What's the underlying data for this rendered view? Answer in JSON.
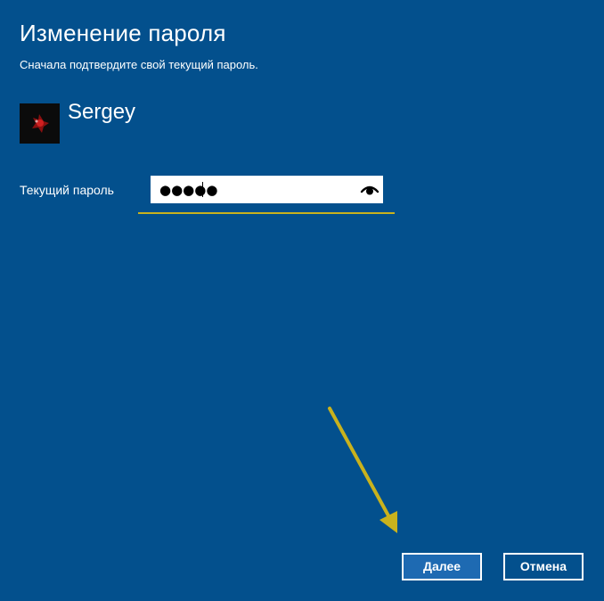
{
  "dialog": {
    "title": "Изменение пароля",
    "subtitle": "Сначала подтвердите свой текущий пароль."
  },
  "user": {
    "name": "Sergey",
    "avatar_icon": "user-avatar-icon"
  },
  "password_field": {
    "label": "Текущий пароль",
    "value": "●●●●●",
    "reveal_icon": "eye-icon",
    "focus_color": "#c9b21d"
  },
  "buttons": {
    "next_label": "Далее",
    "cancel_label": "Отмена"
  },
  "colors": {
    "background": "#03508d",
    "accent": "#1e6ab2",
    "annotation_arrow": "#c9b21d"
  }
}
